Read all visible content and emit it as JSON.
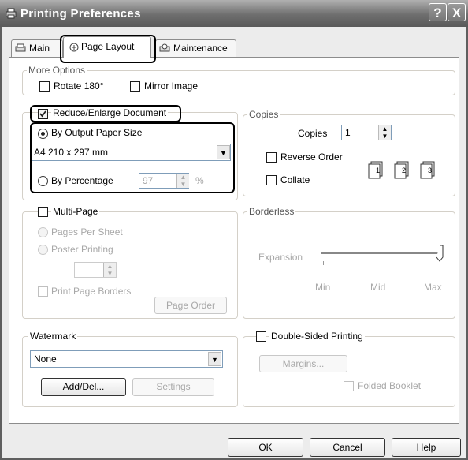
{
  "window": {
    "title": "Printing Preferences",
    "help_label": "?",
    "close_label": "X"
  },
  "tabs": [
    {
      "label": "Main"
    },
    {
      "label": "Page Layout"
    },
    {
      "label": "Maintenance"
    }
  ],
  "more_options": {
    "legend": "More Options",
    "rotate_label": "Rotate 180°",
    "mirror_label": "Mirror Image"
  },
  "reduce": {
    "checkbox_label": "Reduce/Enlarge Document",
    "by_output_label": "By Output Paper Size",
    "paper_size_value": "A4 210 x 297 mm",
    "by_percentage_label": "By Percentage",
    "percentage_value": "97",
    "percent_unit": "%"
  },
  "copies": {
    "legend": "Copies",
    "copies_label": "Copies",
    "copies_value": "1",
    "reverse_order_label": "Reverse Order",
    "collate_label": "Collate"
  },
  "multi_page": {
    "checkbox_label": "Multi-Page",
    "pages_per_sheet_label": "Pages Per Sheet",
    "poster_printing_label": "Poster Printing",
    "print_page_borders_label": "Print Page Borders",
    "page_order_label": "Page Order"
  },
  "borderless": {
    "legend": "Borderless",
    "expansion_label": "Expansion",
    "min_label": "Min",
    "mid_label": "Mid",
    "max_label": "Max"
  },
  "watermark": {
    "legend": "Watermark",
    "value": "None",
    "add_del_label": "Add/Del...",
    "settings_label": "Settings"
  },
  "double_sided": {
    "checkbox_label": "Double-Sided Printing",
    "margins_label": "Margins...",
    "folded_booklet_label": "Folded Booklet"
  },
  "footer": {
    "ok_label": "OK",
    "cancel_label": "Cancel",
    "help_label": "Help"
  }
}
